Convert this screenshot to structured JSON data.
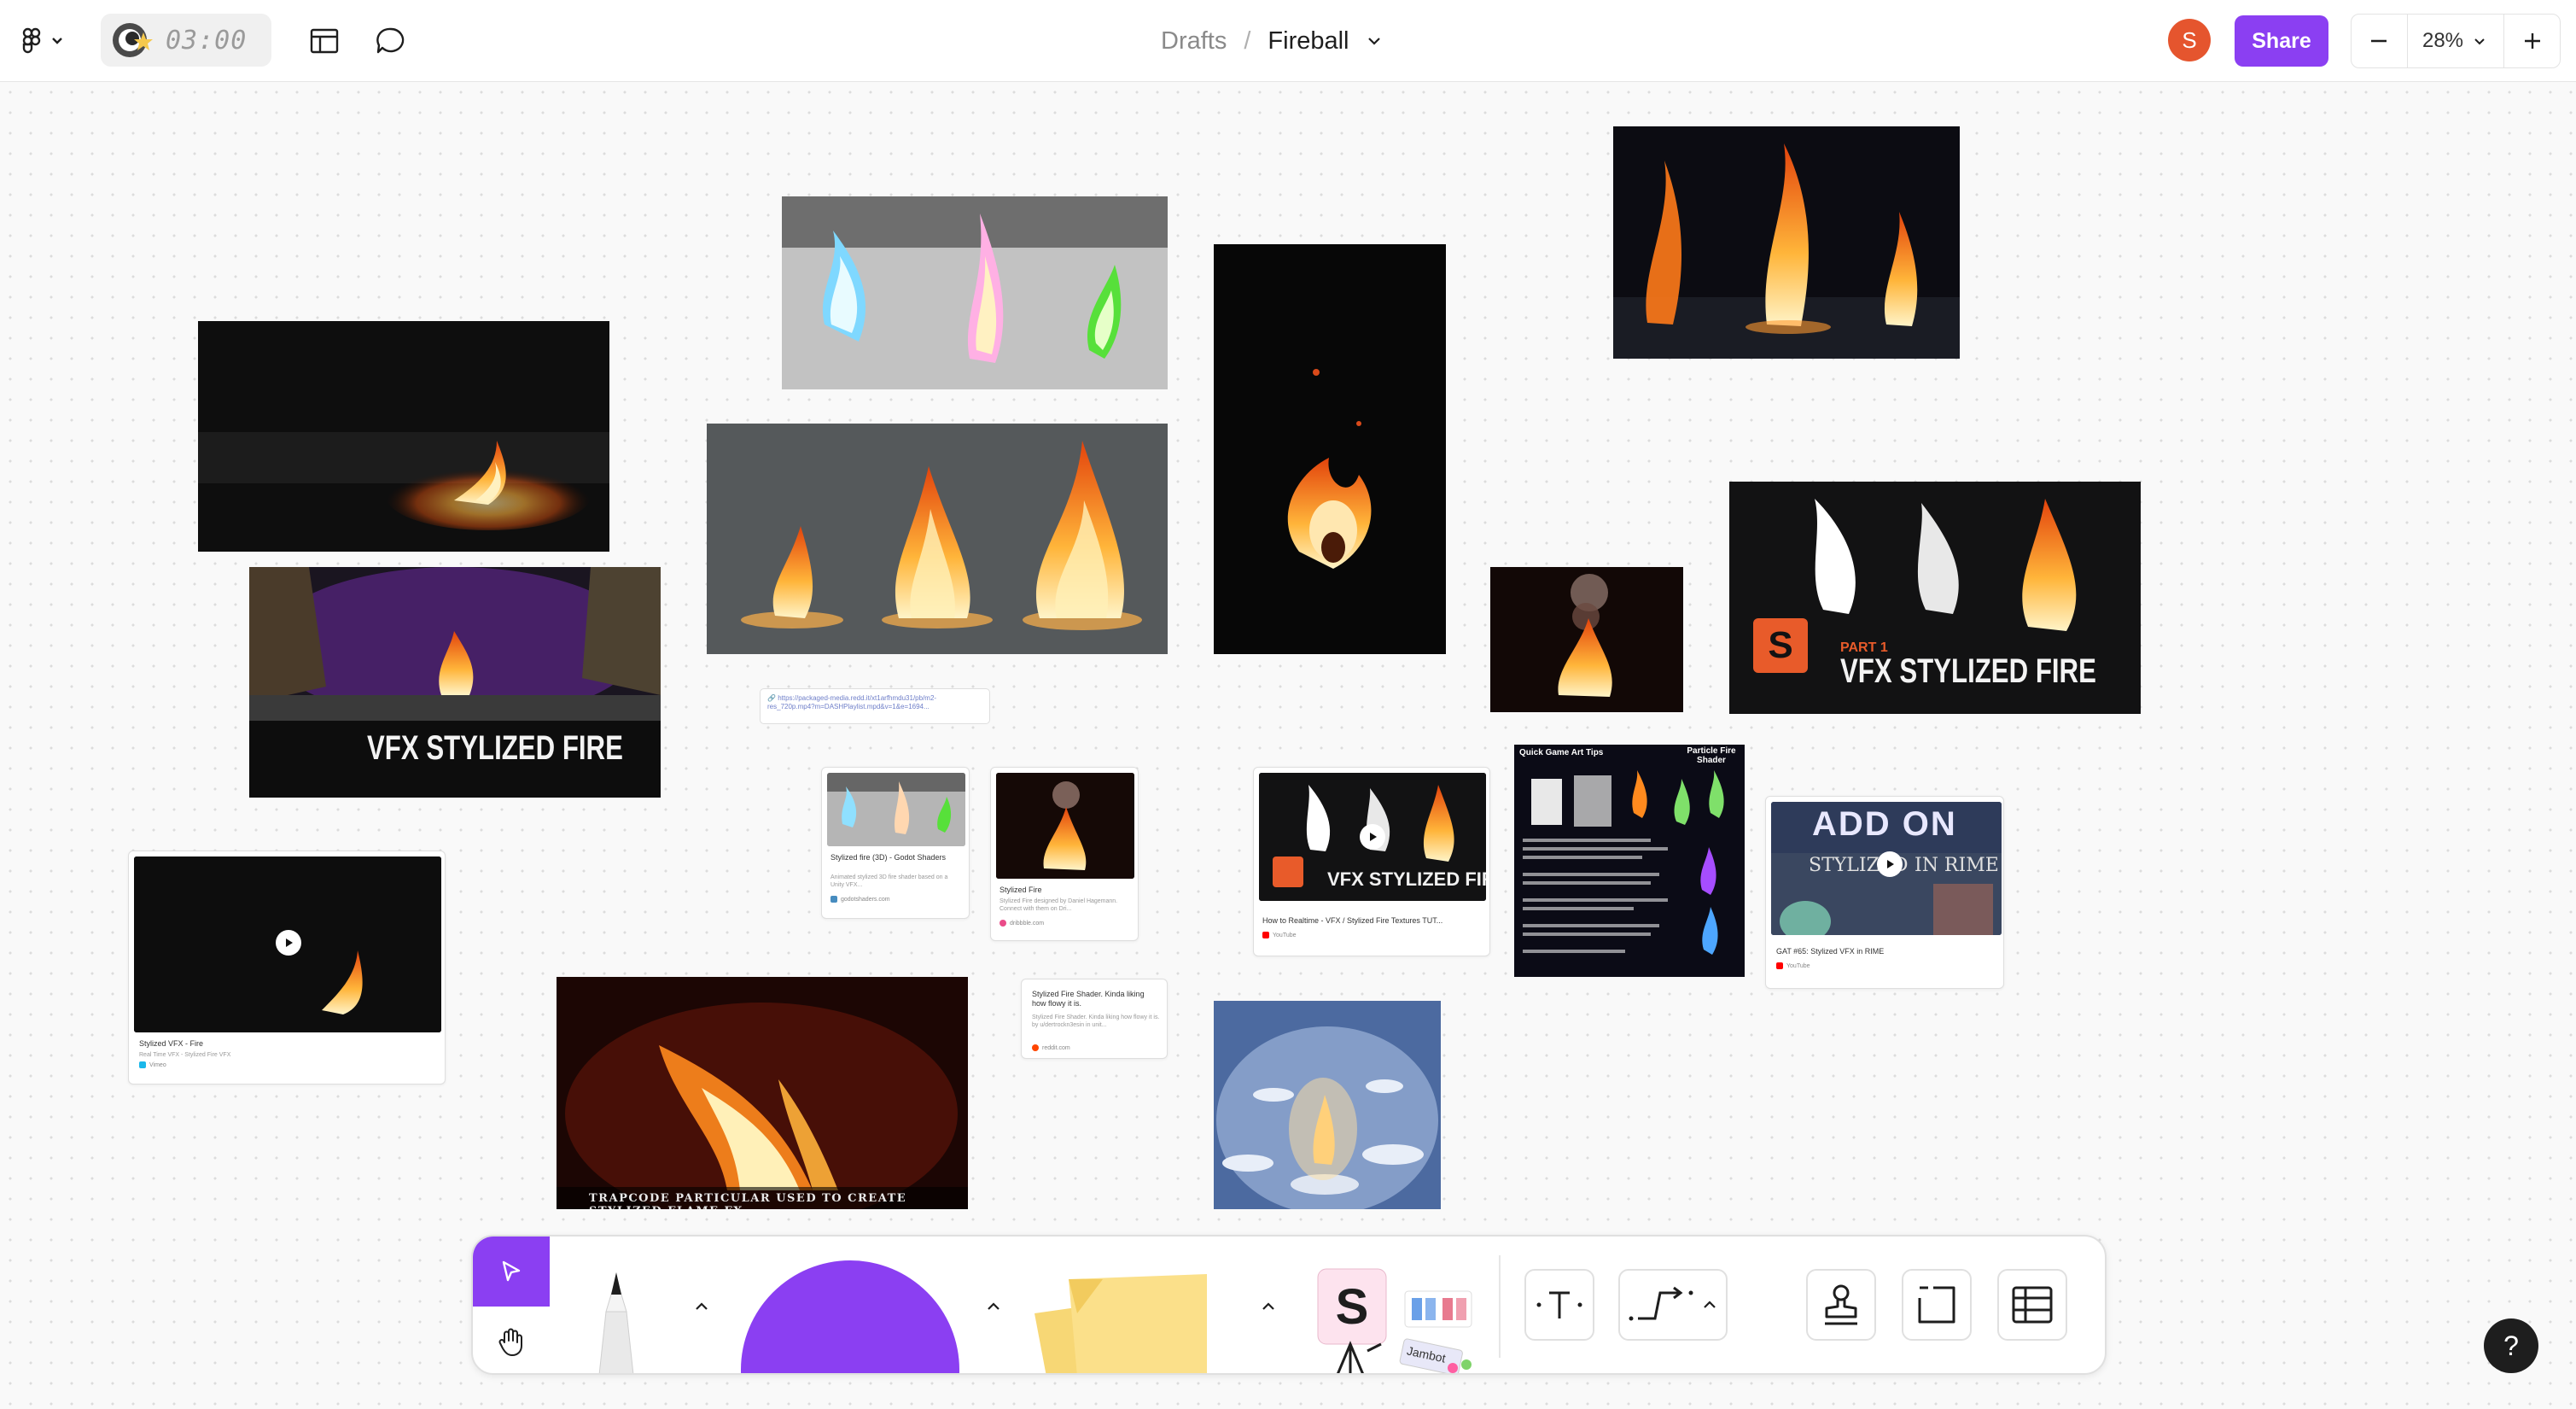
{
  "topbar": {
    "menu_icon": "figjam-logo-icon",
    "timer": "03:00",
    "breadcrumb": {
      "folder": "Drafts",
      "separator": "/",
      "file": "Fireball"
    },
    "avatar_initial": "S",
    "share_label": "Share",
    "zoom": "28%"
  },
  "canvas": {
    "tiles": {
      "vfx_banner_title": "VFX STYLIZED FIRE",
      "part1_label": "PART 1",
      "part1_title": "VFX STYLIZED FIRE",
      "trapcode_caption": "Trapcode Particular used to create stylized flame fx",
      "addon_title": "ADD ON",
      "addon_sub_left": "STYLIZED",
      "addon_sub_right": "IN RIME",
      "cheat_title": "Quick Game Art Tips",
      "cheat_subtitle": "Particle Fire Shader"
    },
    "link_url": "https://packaged-media.redd.it/xt1arfhmdu31/pb/m2-res_720p.mp4?m=DASHPlaylist.mpd&v=1&e=1694...",
    "cards": [
      {
        "title": "Stylized VFX - Fire",
        "desc": "Real Time VFX - Stylized Fire VFX",
        "source": "Vimeo"
      },
      {
        "title": "Stylized fire (3D) - Godot Shaders",
        "desc": "Animated stylized 3D fire shader based on a Unity VFX...",
        "source": "godotshaders.com"
      },
      {
        "title": "Stylized Fire",
        "desc": "Stylized Fire designed by Daniel Hagemann. Connect with them on Dri...",
        "source": "dribbble.com"
      },
      {
        "title": "How to Realtime - VFX / Stylized Fire Textures TUT...",
        "desc": "",
        "source": "YouTube"
      },
      {
        "title": "GAT #65: Stylized VFX in RIME",
        "desc": "",
        "source": "YouTube"
      },
      {
        "title": "Stylized Fire Shader. Kinda liking how flowy it is.",
        "desc": "Stylized Fire Shader. Kinda liking how flowy it is. by u/dertrockn3esin in unit...",
        "source": "reddit.com"
      }
    ]
  },
  "toolbar": {
    "tools": [
      "select-tool",
      "hand-tool",
      "marker-tool",
      "shape-tool",
      "sticky-note-tool",
      "stamp-sticker-tool",
      "text-tool",
      "connector-tool",
      "stamp-tool",
      "section-tool",
      "table-tool"
    ],
    "active_color": "#8b3ff2",
    "sticker_label": "Jambot"
  },
  "help_label": "?",
  "colors": {
    "accent": "#8b3ff2",
    "avatar": "#e5552e",
    "fire": "#ff8a1e"
  }
}
